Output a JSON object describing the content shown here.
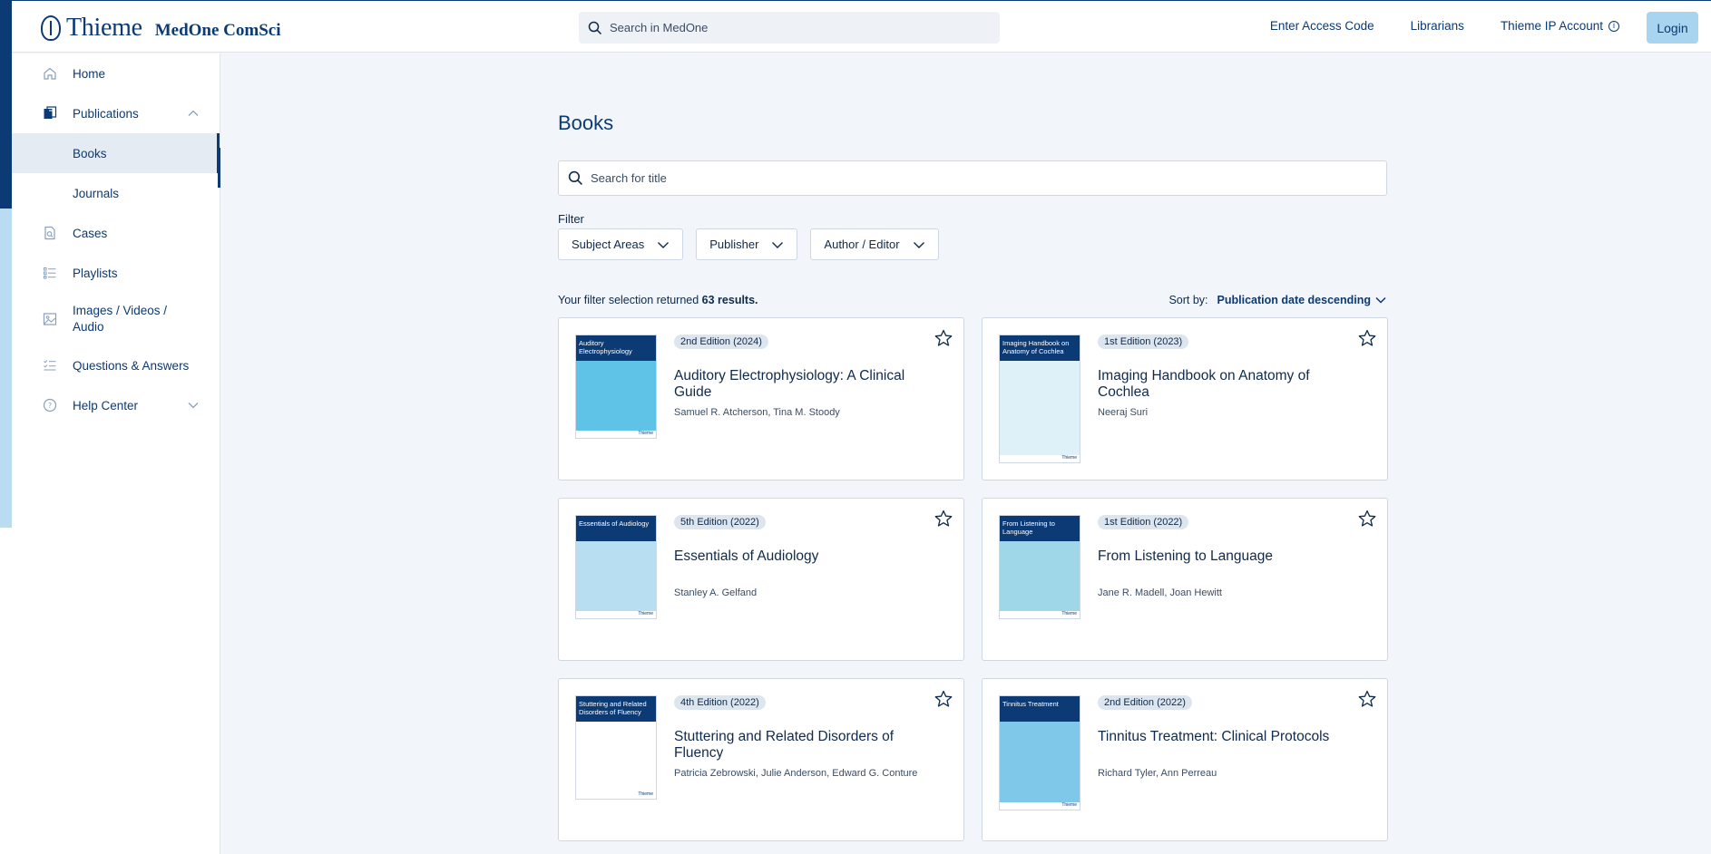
{
  "header": {
    "brand": "Thieme",
    "product": "MedOne ComSci",
    "search_placeholder": "Search in MedOne",
    "links": [
      "Enter Access Code",
      "Librarians",
      "Thieme IP Account"
    ],
    "login_label": "Login"
  },
  "sidebar": {
    "items": [
      {
        "label": "Home",
        "icon": "home-icon"
      },
      {
        "label": "Publications",
        "icon": "publications-icon",
        "expanded": true
      },
      {
        "label": "Books",
        "sub": true,
        "selected": true
      },
      {
        "label": "Journals",
        "sub": true
      },
      {
        "label": "Cases",
        "icon": "cases-icon"
      },
      {
        "label": "Playlists",
        "icon": "playlist-icon"
      },
      {
        "label": "Images / Videos / Audio",
        "icon": "image-icon"
      },
      {
        "label": "Questions & Answers",
        "icon": "qa-icon"
      },
      {
        "label": "Help Center",
        "icon": "help-icon",
        "expanded": false
      }
    ]
  },
  "main": {
    "title": "Books",
    "title_search_placeholder": "Search for title",
    "filter_label": "Filter",
    "filters": [
      "Subject Areas",
      "Publisher",
      "Author / Editor"
    ],
    "results_prefix": "Your filter selection returned",
    "results_count": "63 results.",
    "sort_label": "Sort by:",
    "sort_value": "Publication date descending"
  },
  "books": [
    {
      "edition": "2nd Edition (2024)",
      "title": "Auditory Electrophysiology: A Clinical Guide",
      "authors": "Samuel R. Atcherson, Tina M. Stoody",
      "cover_title": "Auditory Electrophysiology",
      "cover_color": "#5fc3e8"
    },
    {
      "edition": "1st Edition (2023)",
      "title": "Imaging Handbook on Anatomy of Cochlea",
      "authors": "Neeraj Suri",
      "cover_title": "Imaging Handbook on Anatomy of Cochlea",
      "cover_color": "#dff1f8"
    },
    {
      "edition": "5th Edition (2022)",
      "title": "Essentials of Audiology",
      "authors": "Stanley A. Gelfand",
      "cover_title": "Essentials of Audiology",
      "cover_color": "#b8def2"
    },
    {
      "edition": "1st Edition (2022)",
      "title": "From Listening to Language",
      "authors": "Jane R. Madell, Joan Hewitt",
      "cover_title": "From Listening to Language",
      "cover_color": "#9fd6e8"
    },
    {
      "edition": "4th Edition (2022)",
      "title": "Stuttering and Related Disorders of Fluency",
      "authors": "Patricia Zebrowski, Julie Anderson, Edward G. Conture",
      "cover_title": "Stuttering and Related Disorders of Fluency",
      "cover_color": "#ffffff"
    },
    {
      "edition": "2nd Edition (2022)",
      "title": "Tinnitus Treatment: Clinical Protocols",
      "authors": "Richard Tyler, Ann Perreau",
      "cover_title": "Tinnitus Treatment",
      "cover_color": "#7fc8ea"
    }
  ]
}
